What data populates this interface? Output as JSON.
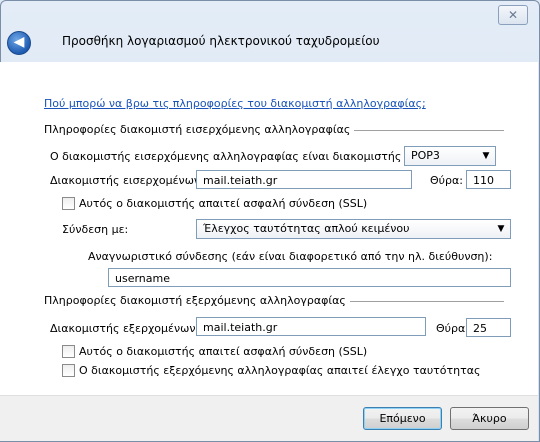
{
  "window": {
    "title": "Προσθήκη λογαριασμού ηλεκτρονικού ταχυδρομείου",
    "close_glyph": "✕",
    "back_glyph": "◀"
  },
  "help_link": "Πού μπορώ να βρω τις πληροφορίες του διακομιστή αλληλογραφίας;",
  "incoming": {
    "section_title": "Πληροφορίες διακομιστή εισερχόμενης αλληλογραφίας",
    "server_type_label": "Ο διακομιστής εισερχόμενης αλληλογραφίας είναι διακομιστής",
    "server_type_value": "POP3",
    "server_label": "Διακομιστής εισερχομένων:",
    "server_value": "mail.teiath.gr",
    "port_label": "Θύρα:",
    "port_value": "110",
    "ssl_label": "Αυτός ο διακομιστής απαιτεί ασφαλή σύνδεση (SSL)",
    "ssl_checked": false,
    "logon_label": "Σύνδεση με:",
    "logon_value": "Έλεγχος ταυτότητας απλού κειμένου",
    "login_id_label": "Αναγνωριστικό σύνδεσης (εάν είναι διαφορετικό από την ηλ. διεύθυνση):",
    "login_id_value": "username"
  },
  "outgoing": {
    "section_title": "Πληροφορίες διακομιστή εξερχόμενης αλληλογραφίας",
    "server_label": "Διακομιστής εξερχομένων:",
    "server_value": "mail.teiath.gr",
    "port_label": "Θύρα:",
    "port_value": "25",
    "ssl_label": "Αυτός ο διακομιστής απαιτεί ασφαλή σύνδεση (SSL)",
    "ssl_checked": false,
    "auth_label": "Ο διακομιστής εξερχόμενης αλληλογραφίας απαιτεί έλεγχο ταυτότητας",
    "auth_checked": false
  },
  "buttons": {
    "next": "Επόμενο",
    "cancel": "Άκυρο"
  },
  "colors": {
    "link": "#1a53b8",
    "frame": "#d5e2f1",
    "default_button_border": "#3c7fb1"
  },
  "icons": {
    "dropdown": "▼"
  }
}
